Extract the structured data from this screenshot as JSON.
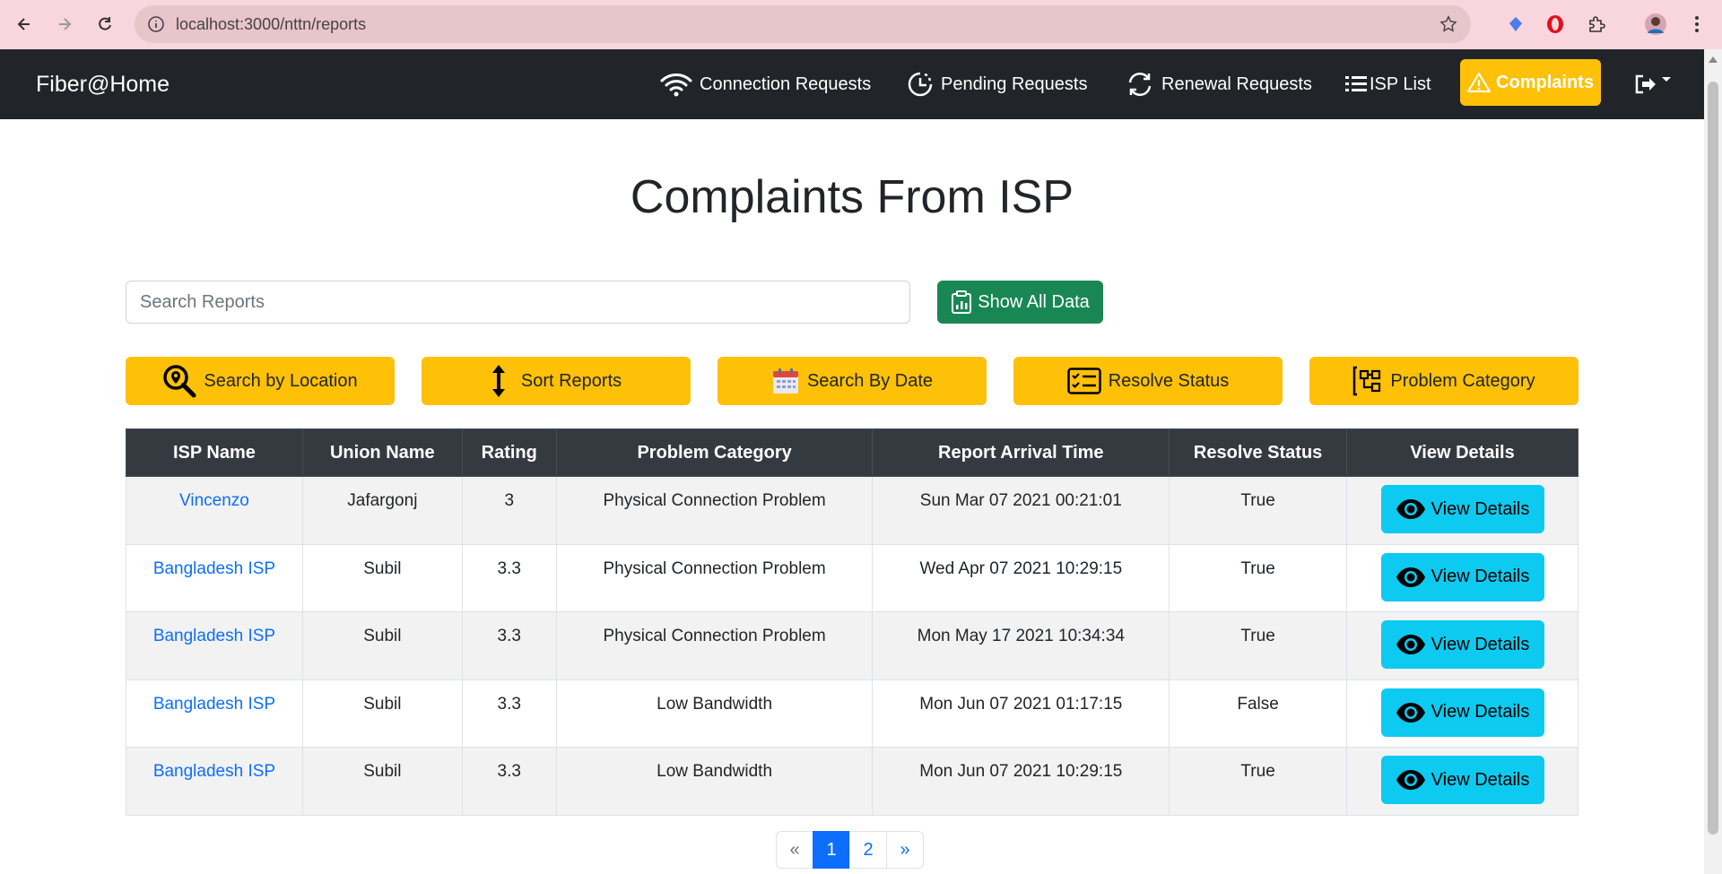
{
  "browser": {
    "url": "localhost:3000/nttn/reports"
  },
  "navbar": {
    "brand": "Fiber@Home",
    "items": [
      {
        "label": "Connection Requests",
        "icon": "wifi-icon"
      },
      {
        "label": "Pending Requests",
        "icon": "clock-history-icon"
      },
      {
        "label": "Renewal Requests",
        "icon": "refresh-icon"
      },
      {
        "label": "ISP List",
        "icon": "list-icon"
      },
      {
        "label": "Complaints",
        "icon": "warning-icon",
        "active": true
      }
    ]
  },
  "page": {
    "title": "Complaints From ISP"
  },
  "search": {
    "placeholder": "Search Reports",
    "show_all_label": "Show All Data"
  },
  "filters": [
    {
      "label": "Search by Location",
      "icon": "location-search-icon"
    },
    {
      "label": "Sort Reports",
      "icon": "sort-arrows-icon"
    },
    {
      "label": "Search By Date",
      "icon": "calendar-icon"
    },
    {
      "label": "Resolve Status",
      "icon": "checklist-icon"
    },
    {
      "label": "Problem Category",
      "icon": "category-icon"
    }
  ],
  "table": {
    "headers": [
      "ISP Name",
      "Union Name",
      "Rating",
      "Problem Category",
      "Report Arrival Time",
      "Resolve Status",
      "View Details"
    ],
    "rows": [
      {
        "isp": "Vincenzo",
        "union": "Jafargonj",
        "rating": "3",
        "category": "Physical Connection Problem",
        "time": "Sun Mar 07 2021 00:21:01",
        "status": "True",
        "action": "View Details"
      },
      {
        "isp": "Bangladesh ISP",
        "union": "Subil",
        "rating": "3.3",
        "category": "Physical Connection Problem",
        "time": "Wed Apr 07 2021 10:29:15",
        "status": "True",
        "action": "View Details"
      },
      {
        "isp": "Bangladesh ISP",
        "union": "Subil",
        "rating": "3.3",
        "category": "Physical Connection Problem",
        "time": "Mon May 17 2021 10:34:34",
        "status": "True",
        "action": "View Details"
      },
      {
        "isp": "Bangladesh ISP",
        "union": "Subil",
        "rating": "3.3",
        "category": "Low Bandwidth",
        "time": "Mon Jun 07 2021 01:17:15",
        "status": "False",
        "action": "View Details"
      },
      {
        "isp": "Bangladesh ISP",
        "union": "Subil",
        "rating": "3.3",
        "category": "Low Bandwidth",
        "time": "Mon Jun 07 2021 10:29:15",
        "status": "True",
        "action": "View Details"
      }
    ]
  },
  "pagination": {
    "prev": "«",
    "pages": [
      "1",
      "2"
    ],
    "next": "»",
    "current": "1"
  },
  "colors": {
    "navbar": "#212529",
    "warning": "#ffc107",
    "success": "#198754",
    "info": "#0dcaf0",
    "link": "#0d6efd"
  }
}
